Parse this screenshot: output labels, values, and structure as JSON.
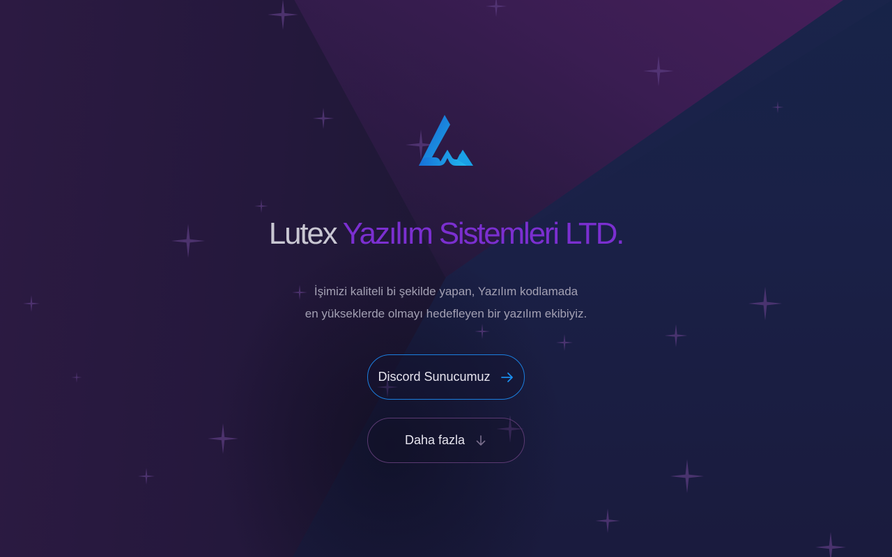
{
  "hero": {
    "title_brand": "Lutex",
    "title_rest": "Yazılım Sistemleri LTD.",
    "desc_line1": "İşimizi kaliteli bi şekilde yapan, Yazılım kodlamada",
    "desc_line2": "en yükseklerde olmayı hedefleyen bir yazılım ekibiyiz."
  },
  "buttons": {
    "discord_label": "Discord Sunucumuz",
    "discord_icon": "arrow-right-icon",
    "more_label": "Daha fazla",
    "more_icon": "arrow-down-icon"
  },
  "colors": {
    "accent_purple": "#7b2fd0",
    "accent_blue": "#1b7fe0",
    "logo_blue": "#1a8fe3"
  }
}
